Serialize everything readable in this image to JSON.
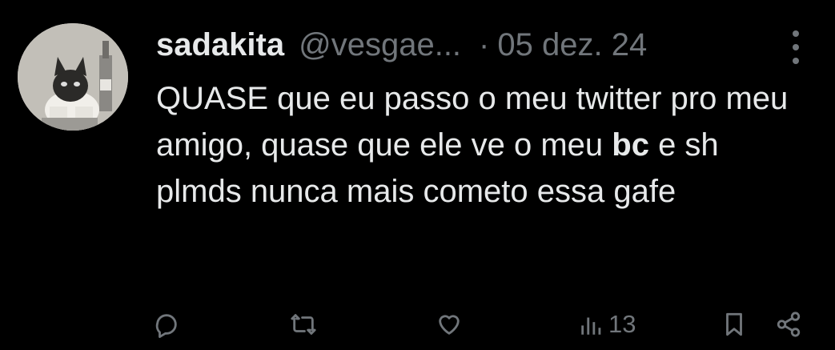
{
  "tweet": {
    "display_name": "sadakita",
    "handle": "@vesgae...",
    "separator": "·",
    "date": "05 dez. 24",
    "text_part1": "QUASE que eu passo o meu twitter pro meu amigo, quase que ele ve o meu ",
    "text_bold": "bc",
    "text_part2": " e sh plmds nunca mais cometo essa gafe"
  },
  "actions": {
    "reply_icon": "reply-icon",
    "retweet_icon": "retweet-icon",
    "like_icon": "heart-icon",
    "views_icon": "views-icon",
    "views_count": "13",
    "bookmark_icon": "bookmark-icon",
    "share_icon": "share-icon"
  },
  "colors": {
    "background": "#000000",
    "text": "#e7e9ea",
    "muted": "#71767b"
  }
}
